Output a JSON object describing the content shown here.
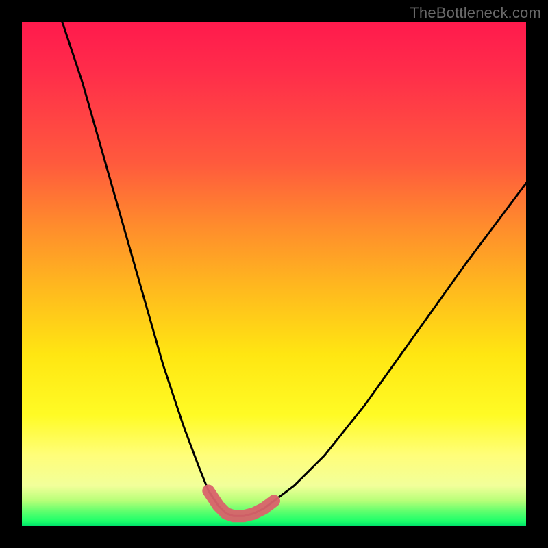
{
  "watermark": "TheBottleneck.com",
  "colors": {
    "background": "#000000",
    "curve_stroke": "#000000",
    "marker_stroke": "#d9636b",
    "gradient_top": "#ff1a4d",
    "gradient_bottom": "#00e26a"
  },
  "chart_data": {
    "type": "line",
    "title": "",
    "xlabel": "",
    "ylabel": "",
    "xlim": [
      0,
      100
    ],
    "ylim": [
      0,
      100
    ],
    "grid": false,
    "legend": false,
    "description": "V-shaped bottleneck curve on vertical red-to-green gradient; minimum region near bottom highlighted with thick pink segment.",
    "series": [
      {
        "name": "bottleneck-curve",
        "x": [
          8,
          12,
          16,
          20,
          24,
          28,
          32,
          35,
          37,
          39,
          40.5,
          42,
          44,
          46,
          48,
          50,
          54,
          60,
          68,
          78,
          88,
          100
        ],
        "y": [
          100,
          88,
          74,
          60,
          46,
          32,
          20,
          12,
          7,
          4,
          2.5,
          2,
          2,
          2.5,
          3.5,
          5,
          8,
          14,
          24,
          38,
          52,
          68
        ]
      }
    ],
    "highlight": {
      "name": "min-region-marker",
      "x": [
        37,
        39,
        40.5,
        42,
        44,
        46,
        48,
        50
      ],
      "y": [
        7,
        4,
        2.5,
        2,
        2,
        2.5,
        3.5,
        5
      ]
    }
  }
}
